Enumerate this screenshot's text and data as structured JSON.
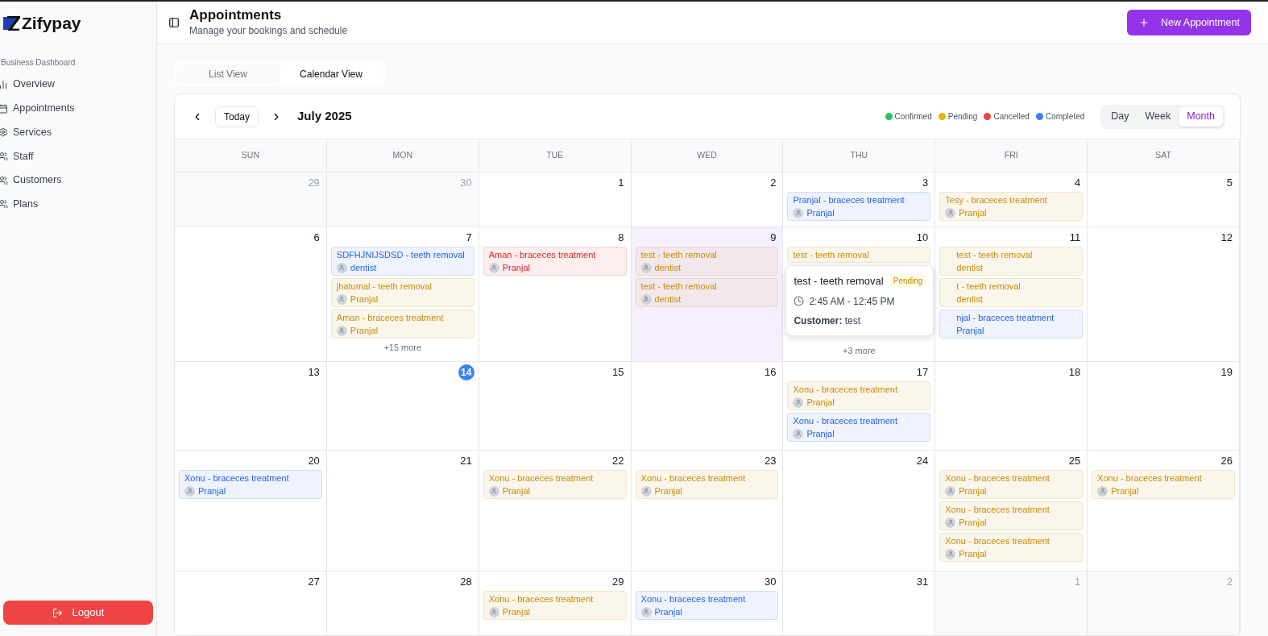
{
  "brand": {
    "name": "Zifypay"
  },
  "sidebar": {
    "section": "Business Dashboard",
    "items": [
      {
        "label": "Overview",
        "kind": "chart",
        "selected": false
      },
      {
        "label": "Appointments",
        "kind": "calendar",
        "selected": false
      },
      {
        "label": "Services",
        "kind": "gear",
        "selected": false
      },
      {
        "label": "Staff",
        "kind": "users",
        "selected": false
      },
      {
        "label": "Customers",
        "kind": "users",
        "selected": false
      },
      {
        "label": "Plans",
        "kind": "users",
        "selected": false
      }
    ],
    "logout": "Logout"
  },
  "header": {
    "title": "Appointments",
    "subtitle": "Manage your bookings and schedule",
    "new_button": "New Appointment"
  },
  "tabs": [
    {
      "label": "List View",
      "selected": false
    },
    {
      "label": "Calendar View",
      "selected": true
    }
  ],
  "calendar": {
    "today_button": "Today",
    "month": "July 2025",
    "legend": [
      {
        "label": "Confirmed",
        "color": "#22c55e"
      },
      {
        "label": "Pending",
        "color": "#eab308"
      },
      {
        "label": "Cancelled",
        "color": "#ef4444"
      },
      {
        "label": "Completed",
        "color": "#3b82f6"
      }
    ],
    "views": [
      {
        "label": "Day",
        "selected": false
      },
      {
        "label": "Week",
        "selected": false
      },
      {
        "label": "Month",
        "selected": true
      }
    ],
    "weekdays": [
      "SUN",
      "MON",
      "TUE",
      "WED",
      "THU",
      "FRI",
      "SAT"
    ],
    "weeks": [
      {
        "days": [
          {
            "date": "29",
            "outside": true
          },
          {
            "date": "30",
            "outside": true
          },
          {
            "date": "1"
          },
          {
            "date": "2"
          },
          {
            "date": "3",
            "events": [
              {
                "title": "Pranjal - braceces treatment",
                "staff": "Pranjal",
                "color": "#2563eb"
              }
            ]
          },
          {
            "date": "4",
            "events": [
              {
                "title": "Tesy - braceces treatment",
                "staff": "Pranjal",
                "color": "#ca8a04"
              }
            ]
          },
          {
            "date": "5"
          }
        ]
      },
      {
        "days": [
          {
            "date": "6"
          },
          {
            "date": "7",
            "events": [
              {
                "title": "SDFHJNIJSDSD - teeth removal",
                "staff": "dentist",
                "color": "#2563eb"
              },
              {
                "title": "jhatumal - teeth removal",
                "staff": "Pranjal",
                "color": "#ca8a04"
              },
              {
                "title": "Aman - braceces treatment",
                "staff": "Pranjal",
                "color": "#ca8a04"
              }
            ],
            "more": "+15 more"
          },
          {
            "date": "8",
            "events": [
              {
                "title": "Aman - braceces treatment",
                "staff": "Pranjal",
                "color": "#dc2626"
              }
            ]
          },
          {
            "date": "9",
            "highlighted": true,
            "events": [
              {
                "title": "test - teeth removal",
                "staff": "dentist",
                "color": "#ca8a04"
              },
              {
                "title": "test - teeth removal",
                "staff": "dentist",
                "color": "#ca8a04"
              }
            ]
          },
          {
            "date": "10",
            "events": [
              {
                "title": "test - teeth removal",
                "color": "#ca8a04"
              }
            ],
            "more": "+3 more",
            "popover": {
              "title": "test - teeth removal",
              "status": "Pending",
              "time": "2:45 AM - 12:45 PM",
              "customer": "**Customer:** test"
            }
          },
          {
            "date": "11",
            "events": [
              {
                "title": "test - teeth removal",
                "staff": "dentist",
                "color": "#ca8a04",
                "covered": true
              },
              {
                "title": "t - teeth removal",
                "staff": "dentist",
                "color": "#ca8a04",
                "covered": true
              },
              {
                "title": "njal - braceces treatment",
                "staff": "Pranjal",
                "color": "#2563eb",
                "covered": true
              }
            ]
          },
          {
            "date": "12"
          }
        ]
      },
      {
        "days": [
          {
            "date": "13"
          },
          {
            "date": "14",
            "today": true
          },
          {
            "date": "15"
          },
          {
            "date": "16"
          },
          {
            "date": "17",
            "events": [
              {
                "title": "Xonu - braceces treatment",
                "staff": "Pranjal",
                "color": "#ca8a04"
              },
              {
                "title": "Xonu - braceces treatment",
                "staff": "Pranjal",
                "color": "#2563eb"
              }
            ]
          },
          {
            "date": "18"
          },
          {
            "date": "19"
          }
        ]
      },
      {
        "days": [
          {
            "date": "20",
            "events": [
              {
                "title": "Xonu - braceces treatment",
                "staff": "Pranjal",
                "color": "#2563eb"
              }
            ]
          },
          {
            "date": "21"
          },
          {
            "date": "22",
            "events": [
              {
                "title": "Xonu - braceces treatment",
                "staff": "Pranjal",
                "color": "#ca8a04"
              }
            ]
          },
          {
            "date": "23",
            "events": [
              {
                "title": "Xonu - braceces treatment",
                "staff": "Pranjal",
                "color": "#ca8a04"
              }
            ]
          },
          {
            "date": "24"
          },
          {
            "date": "25",
            "events": [
              {
                "title": "Xonu - braceces treatment",
                "staff": "Pranjal",
                "color": "#ca8a04"
              },
              {
                "title": "Xonu - braceces treatment",
                "staff": "Pranjal",
                "color": "#ca8a04"
              },
              {
                "title": "Xonu - braceces treatment",
                "staff": "Pranjal",
                "color": "#ca8a04"
              }
            ]
          },
          {
            "date": "26",
            "events": [
              {
                "title": "Xonu - braceces treatment",
                "staff": "Pranjal",
                "color": "#ca8a04"
              }
            ]
          }
        ]
      },
      {
        "days": [
          {
            "date": "27"
          },
          {
            "date": "28"
          },
          {
            "date": "29",
            "events": [
              {
                "title": "Xonu - braceces treatment",
                "staff": "Pranjal",
                "color": "#ca8a04"
              }
            ]
          },
          {
            "date": "30",
            "events": [
              {
                "title": "Xonu - braceces treatment",
                "staff": "Pranjal",
                "color": "#2563eb"
              }
            ]
          },
          {
            "date": "31"
          },
          {
            "date": "1",
            "outside": true
          },
          {
            "date": "2",
            "outside": true
          }
        ]
      }
    ]
  }
}
